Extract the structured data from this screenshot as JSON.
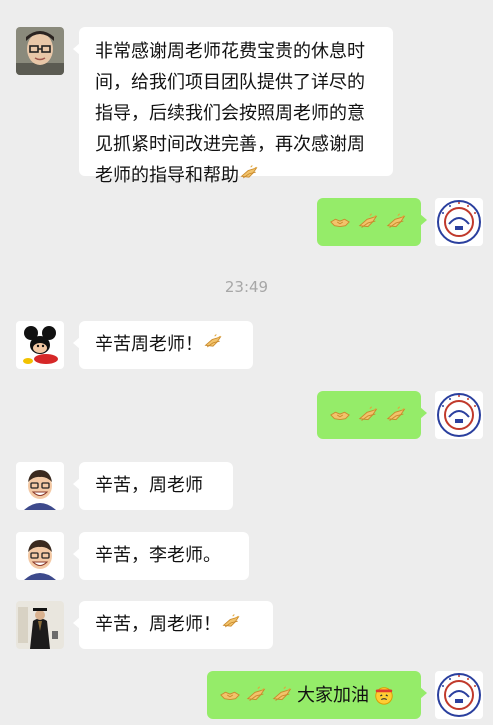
{
  "messages": [
    {
      "direction": "in",
      "sender_avatar": "glasses-man-photo",
      "text": "非常感谢周老师花费宝贵的休息时间，给我们项目团队提供了详尽的指导，后续我们会按照周老师的意见抓紧时间改进完善，再次感谢周老师的指导和帮助",
      "lines": [
        "非常感谢周老师花费宝贵的休息时",
        "间，给我们项目团队提供了详尽的",
        "指导，后续我们会按照周老师的意",
        "见抓紧时间改进完善，再次感谢周",
        "老师的指导和帮助"
      ],
      "trailing_emoji": "clap-hands"
    },
    {
      "direction": "out",
      "sender_avatar": "university-logo",
      "emojis": [
        "handshake",
        "clap-hands",
        "clap-hands"
      ]
    },
    {
      "type": "time",
      "text": "23:49"
    },
    {
      "direction": "in",
      "sender_avatar": "mickey-mouse",
      "text": "辛苦周老师！",
      "trailing_emoji": "clap-hands"
    },
    {
      "direction": "out",
      "sender_avatar": "university-logo",
      "emojis": [
        "handshake",
        "clap-hands",
        "clap-hands"
      ]
    },
    {
      "direction": "in",
      "sender_avatar": "cartoon-man",
      "text": "辛苦，周老师"
    },
    {
      "direction": "in",
      "sender_avatar": "cartoon-man",
      "text": "辛苦，李老师。"
    },
    {
      "direction": "in",
      "sender_avatar": "graduate-figure",
      "text": "辛苦，周老师！",
      "trailing_emoji": "clap-hands"
    },
    {
      "direction": "out",
      "sender_avatar": "university-logo",
      "emojis": [
        "handshake",
        "clap-hands",
        "clap-hands"
      ],
      "text": "大家加油",
      "trailing_emoji": "fighting-face"
    }
  ],
  "colors": {
    "background": "#ededed",
    "incoming_bubble": "#ffffff",
    "outgoing_bubble": "#95ec69",
    "timestamp_text": "#a7a7a7"
  }
}
